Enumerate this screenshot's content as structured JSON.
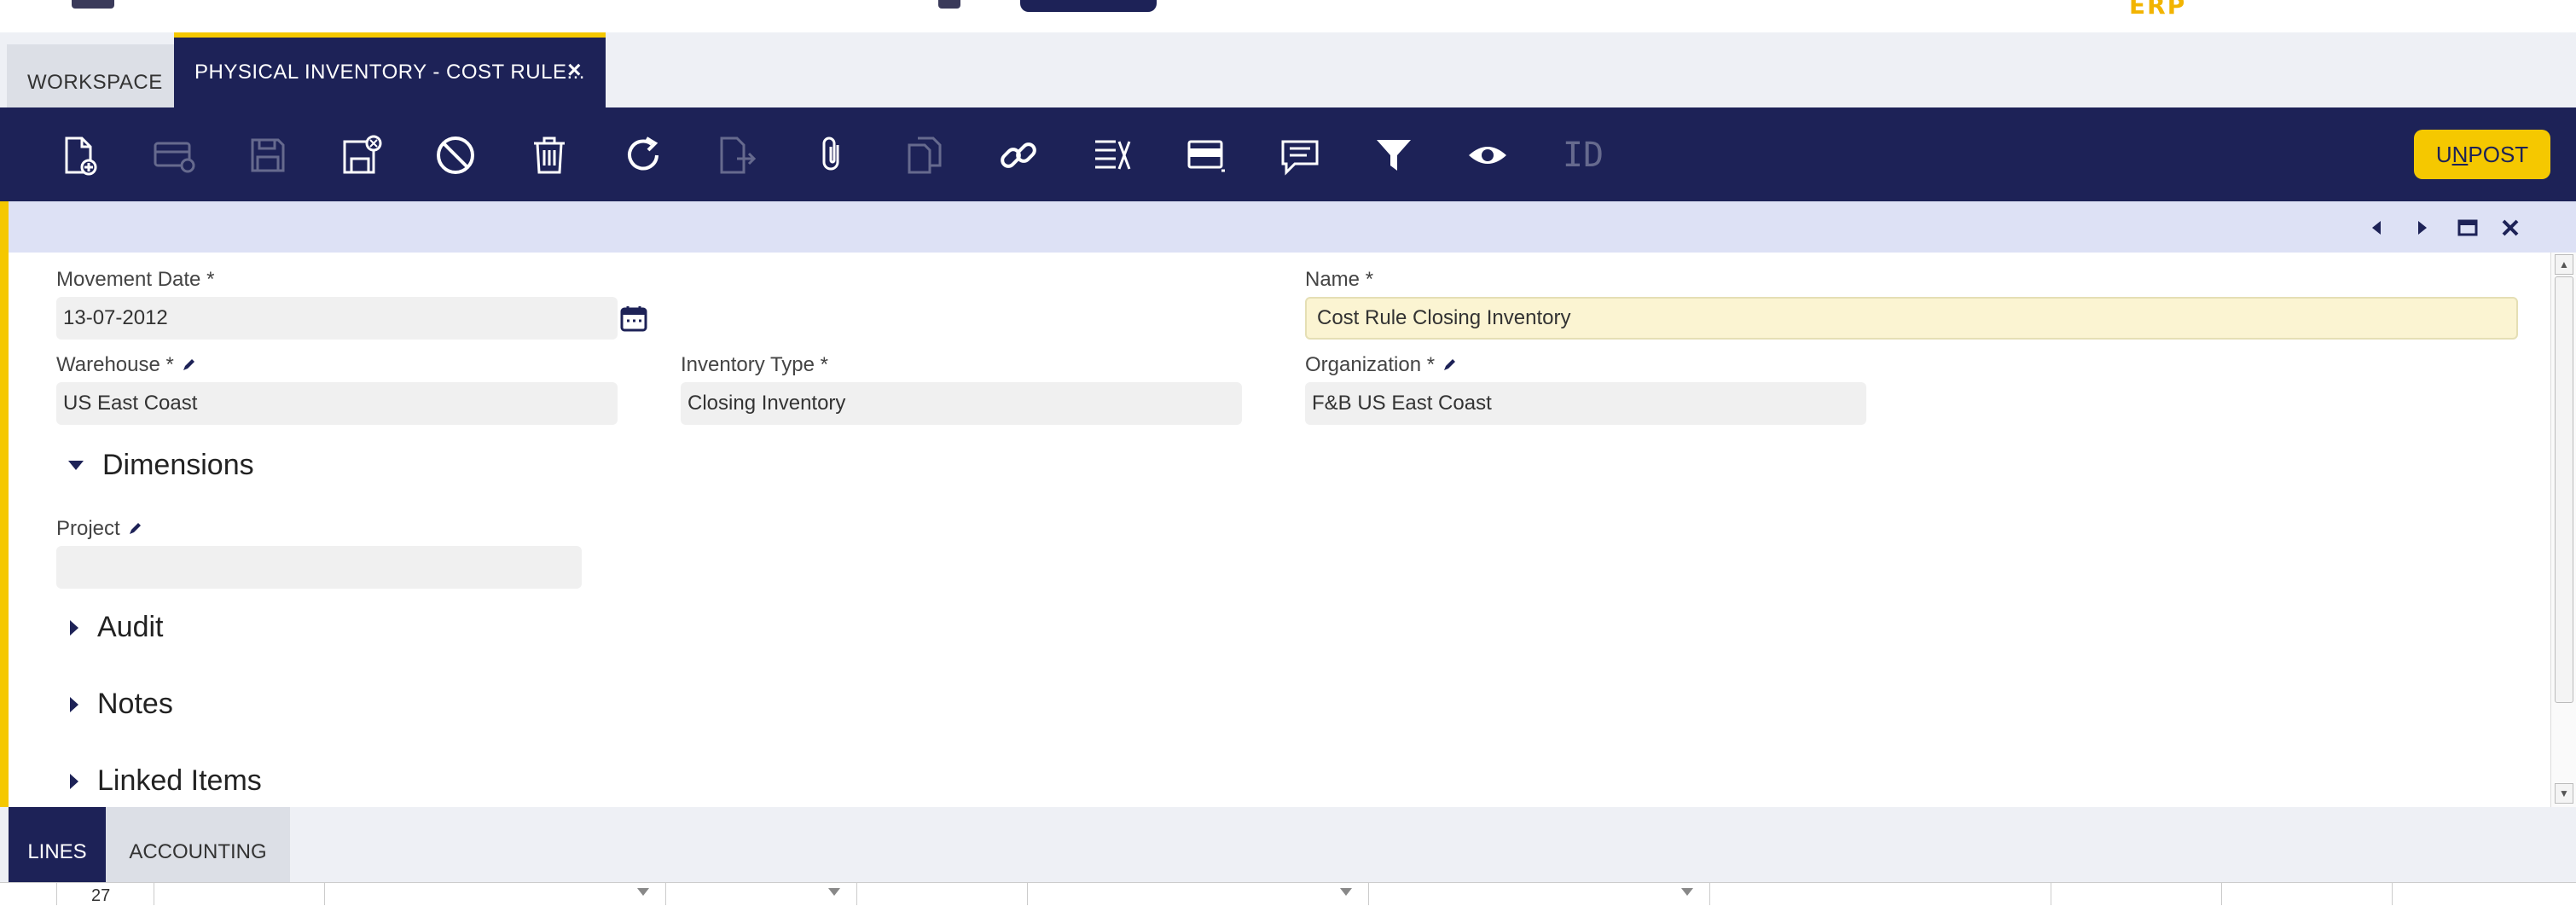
{
  "app": {
    "logo_text": "ERP",
    "colors": {
      "navy": "#1d2257",
      "yellow": "#f5c800",
      "highlight_field": "#fbf4d2"
    }
  },
  "tabs": {
    "workspace_label": "WORKSPACE",
    "active_label": "PHYSICAL INVENTORY - COST RULE...",
    "close_icon": "close-icon"
  },
  "toolbar": {
    "icons": [
      "new-document-icon",
      "new-row-icon",
      "save-icon",
      "save-close-icon",
      "cancel-icon",
      "delete-icon",
      "refresh-icon",
      "export-icon",
      "attachment-icon",
      "clone-icon",
      "link-icon",
      "print-config-icon",
      "layout-icon",
      "notes-icon",
      "filter-icon",
      "view-icon",
      "id-icon"
    ],
    "id_label": "ID",
    "unpost_prefix": "U",
    "unpost_underlined": "N",
    "unpost_suffix": "POST"
  },
  "form": {
    "movement_date": {
      "label": "Movement Date *",
      "value": "13-07-2012"
    },
    "name": {
      "label": "Name *",
      "value": "Cost Rule Closing Inventory"
    },
    "warehouse": {
      "label": "Warehouse *",
      "value": "US East Coast"
    },
    "inventory_type": {
      "label": "Inventory Type *",
      "value": "Closing Inventory"
    },
    "organization": {
      "label": "Organization *",
      "value": "F&B US East Coast"
    },
    "project": {
      "label": "Project",
      "value": ""
    }
  },
  "sections": {
    "dimensions": "Dimensions",
    "audit": "Audit",
    "notes": "Notes",
    "linked_items": "Linked Items"
  },
  "bottom_tabs": {
    "lines": "LINES",
    "accounting": "ACCOUNTING"
  },
  "grid": {
    "first_row_number": "27"
  }
}
